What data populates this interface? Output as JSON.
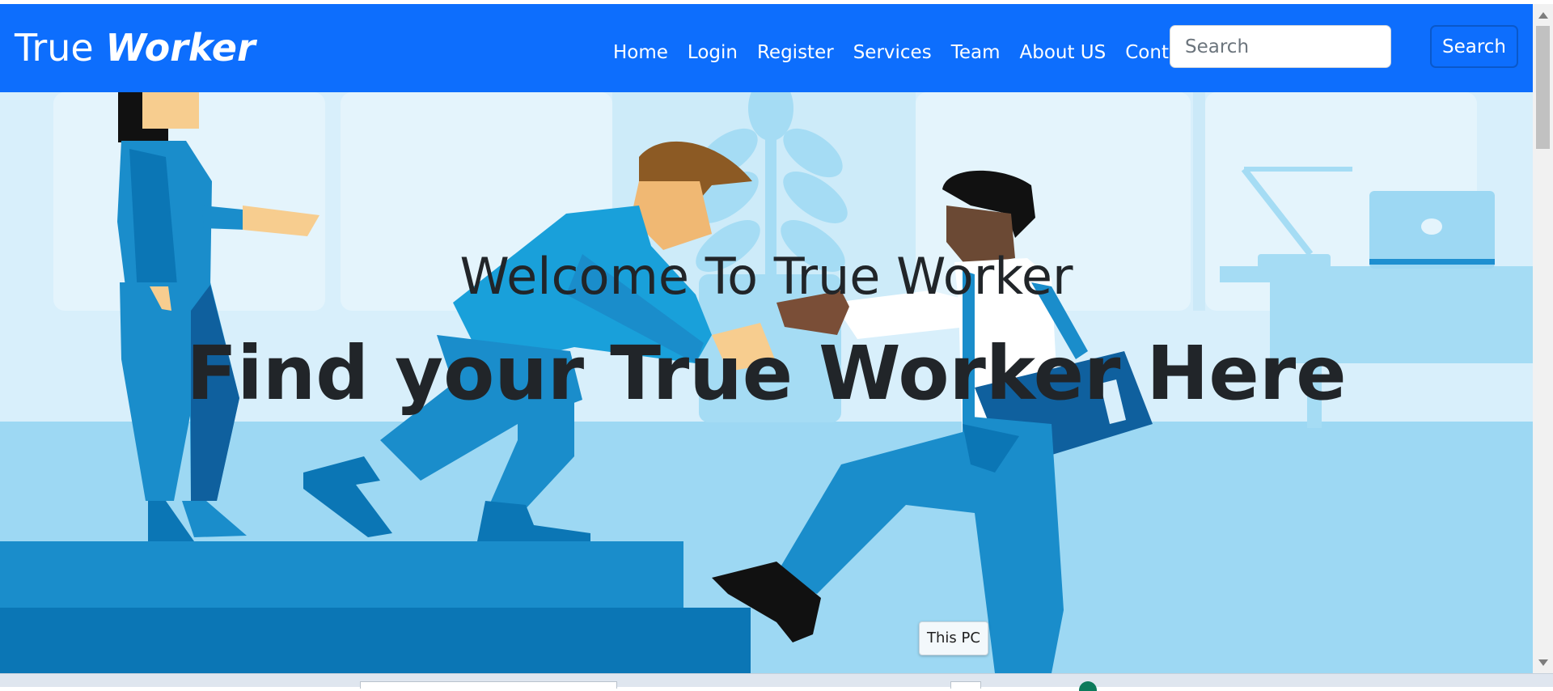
{
  "navbar": {
    "brand_part1": "True",
    "brand_part2": "Worker",
    "links": [
      "Home",
      "Login",
      "Register",
      "Services",
      "Team",
      "About US",
      "Contact"
    ],
    "search_placeholder": "Search",
    "search_button": "Search"
  },
  "hero": {
    "subtitle": "Welcome To True Worker",
    "title": "Find your True Worker Here"
  },
  "tooltip": "This PC",
  "colors": {
    "navbar_bg": "#0d6efd",
    "hero_bg": "#d8effb",
    "text_dark": "#212529"
  }
}
